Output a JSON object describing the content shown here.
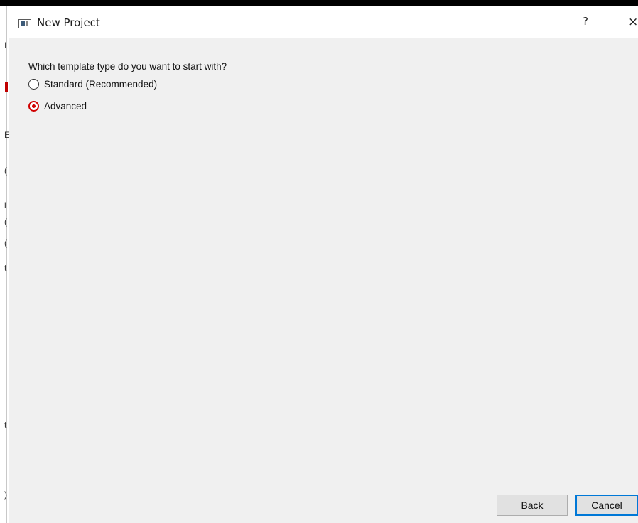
{
  "window": {
    "title": "New Project",
    "help_label": "?",
    "close_label": "×"
  },
  "left_fragments": [
    "I",
    "E",
    "(",
    "l",
    "(",
    "(",
    "t",
    "t",
    ")"
  ],
  "page": {
    "question": "Which template type do you want to start with?",
    "options": [
      {
        "label": "Standard (Recommended)",
        "selected": false
      },
      {
        "label": "Advanced",
        "selected": true
      }
    ]
  },
  "footer": {
    "back_label": "Back",
    "cancel_label": "Cancel"
  },
  "colors": {
    "accent": "#0078d7",
    "selected_radio": "#d00000",
    "dialog_bg": "#f0f0f0"
  }
}
